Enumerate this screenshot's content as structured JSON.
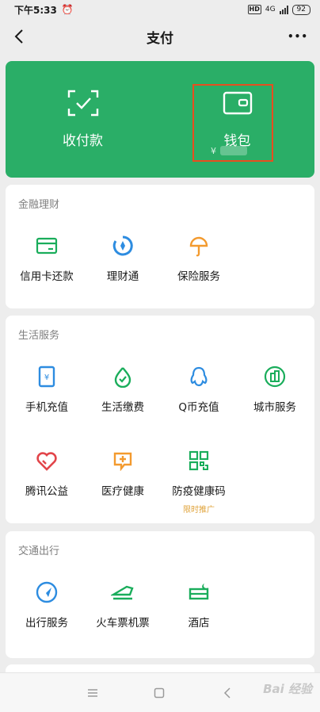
{
  "status_bar": {
    "time": "下午5:33",
    "alarm_icon": "alarm-clock-icon",
    "hd": "HD",
    "network": "4G",
    "battery": "92"
  },
  "header": {
    "title": "支付",
    "back_icon": "chevron-left-icon",
    "more_label": "•••"
  },
  "hero": {
    "pay_label": "收付款",
    "wallet_label": "钱包",
    "wallet_balance_prefix": "¥",
    "background_color": "#2aae67",
    "highlight_color": "#e84e1f"
  },
  "sections": {
    "finance": {
      "title": "金融理财",
      "items": [
        {
          "label": "信用卡还款",
          "icon": "credit-card-icon"
        },
        {
          "label": "理财通",
          "icon": "wealth-icon"
        },
        {
          "label": "保险服务",
          "icon": "insurance-umbrella-icon"
        }
      ]
    },
    "life": {
      "title": "生活服务",
      "items": [
        {
          "label": "手机充值",
          "icon": "phone-recharge-icon"
        },
        {
          "label": "生活缴费",
          "icon": "utility-bill-icon"
        },
        {
          "label": "Q币充值",
          "icon": "qq-penguin-icon"
        },
        {
          "label": "城市服务",
          "icon": "city-buildings-icon"
        },
        {
          "label": "腾讯公益",
          "icon": "charity-heart-icon"
        },
        {
          "label": "医疗健康",
          "icon": "medical-cross-icon"
        },
        {
          "label": "防疫健康码",
          "icon": "qr-code-icon",
          "sub": "限时推广"
        }
      ]
    },
    "transport": {
      "title": "交通出行",
      "items": [
        {
          "label": "出行服务",
          "icon": "navigation-arrow-icon"
        },
        {
          "label": "火车票机票",
          "icon": "train-icon"
        },
        {
          "label": "酒店",
          "icon": "hotel-bed-icon"
        }
      ]
    }
  },
  "watermark": "Bai 经验"
}
